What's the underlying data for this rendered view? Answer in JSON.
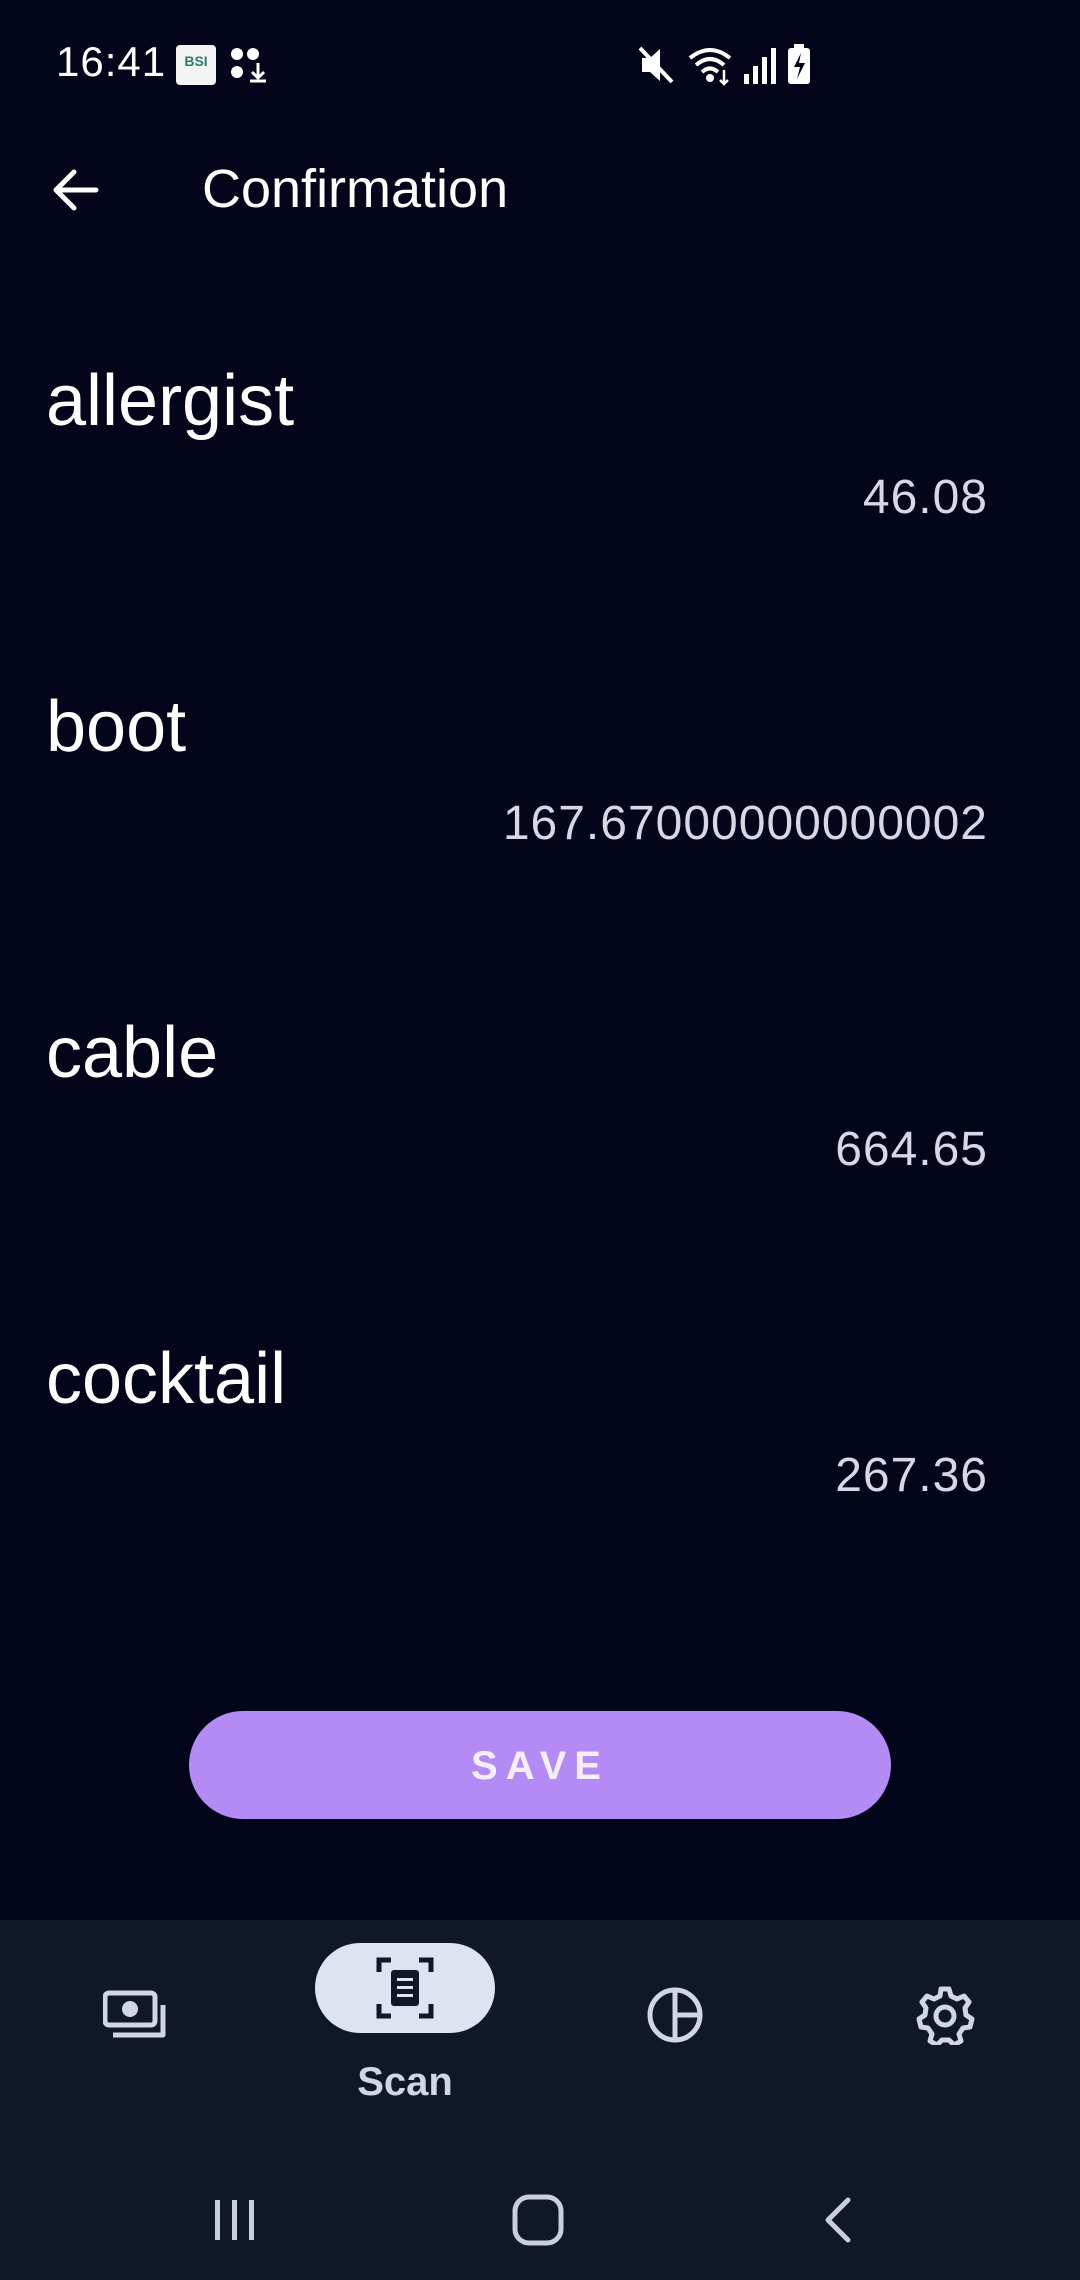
{
  "status_bar": {
    "time": "16:41",
    "app_icon_text": "BSI",
    "icons": [
      "app-notification-icon",
      "dots-download-icon",
      "mute-icon",
      "wifi-icon",
      "signal-icon",
      "battery-charging-icon"
    ]
  },
  "header": {
    "title": "Confirmation",
    "back_icon": "arrow-left-icon"
  },
  "items": [
    {
      "name": "allergist",
      "value": "46.08"
    },
    {
      "name": "boot",
      "value": "167.67000000000002"
    },
    {
      "name": "cable",
      "value": "664.65"
    },
    {
      "name": "cocktail",
      "value": "267.36"
    }
  ],
  "save_button": {
    "label": "SAVE"
  },
  "bottom_nav": {
    "items": [
      {
        "icon": "money-icon",
        "label": ""
      },
      {
        "icon": "scan-document-icon",
        "label": "Scan",
        "active": true
      },
      {
        "icon": "pie-chart-icon",
        "label": ""
      },
      {
        "icon": "gear-icon",
        "label": ""
      }
    ]
  },
  "system_nav": {
    "icons": [
      "recent-apps-icon",
      "home-icon",
      "back-icon"
    ]
  },
  "colors": {
    "background": "#03051a",
    "accent": "#b48bf5",
    "nav_background": "#101728",
    "active_pill": "#dde3f1"
  }
}
